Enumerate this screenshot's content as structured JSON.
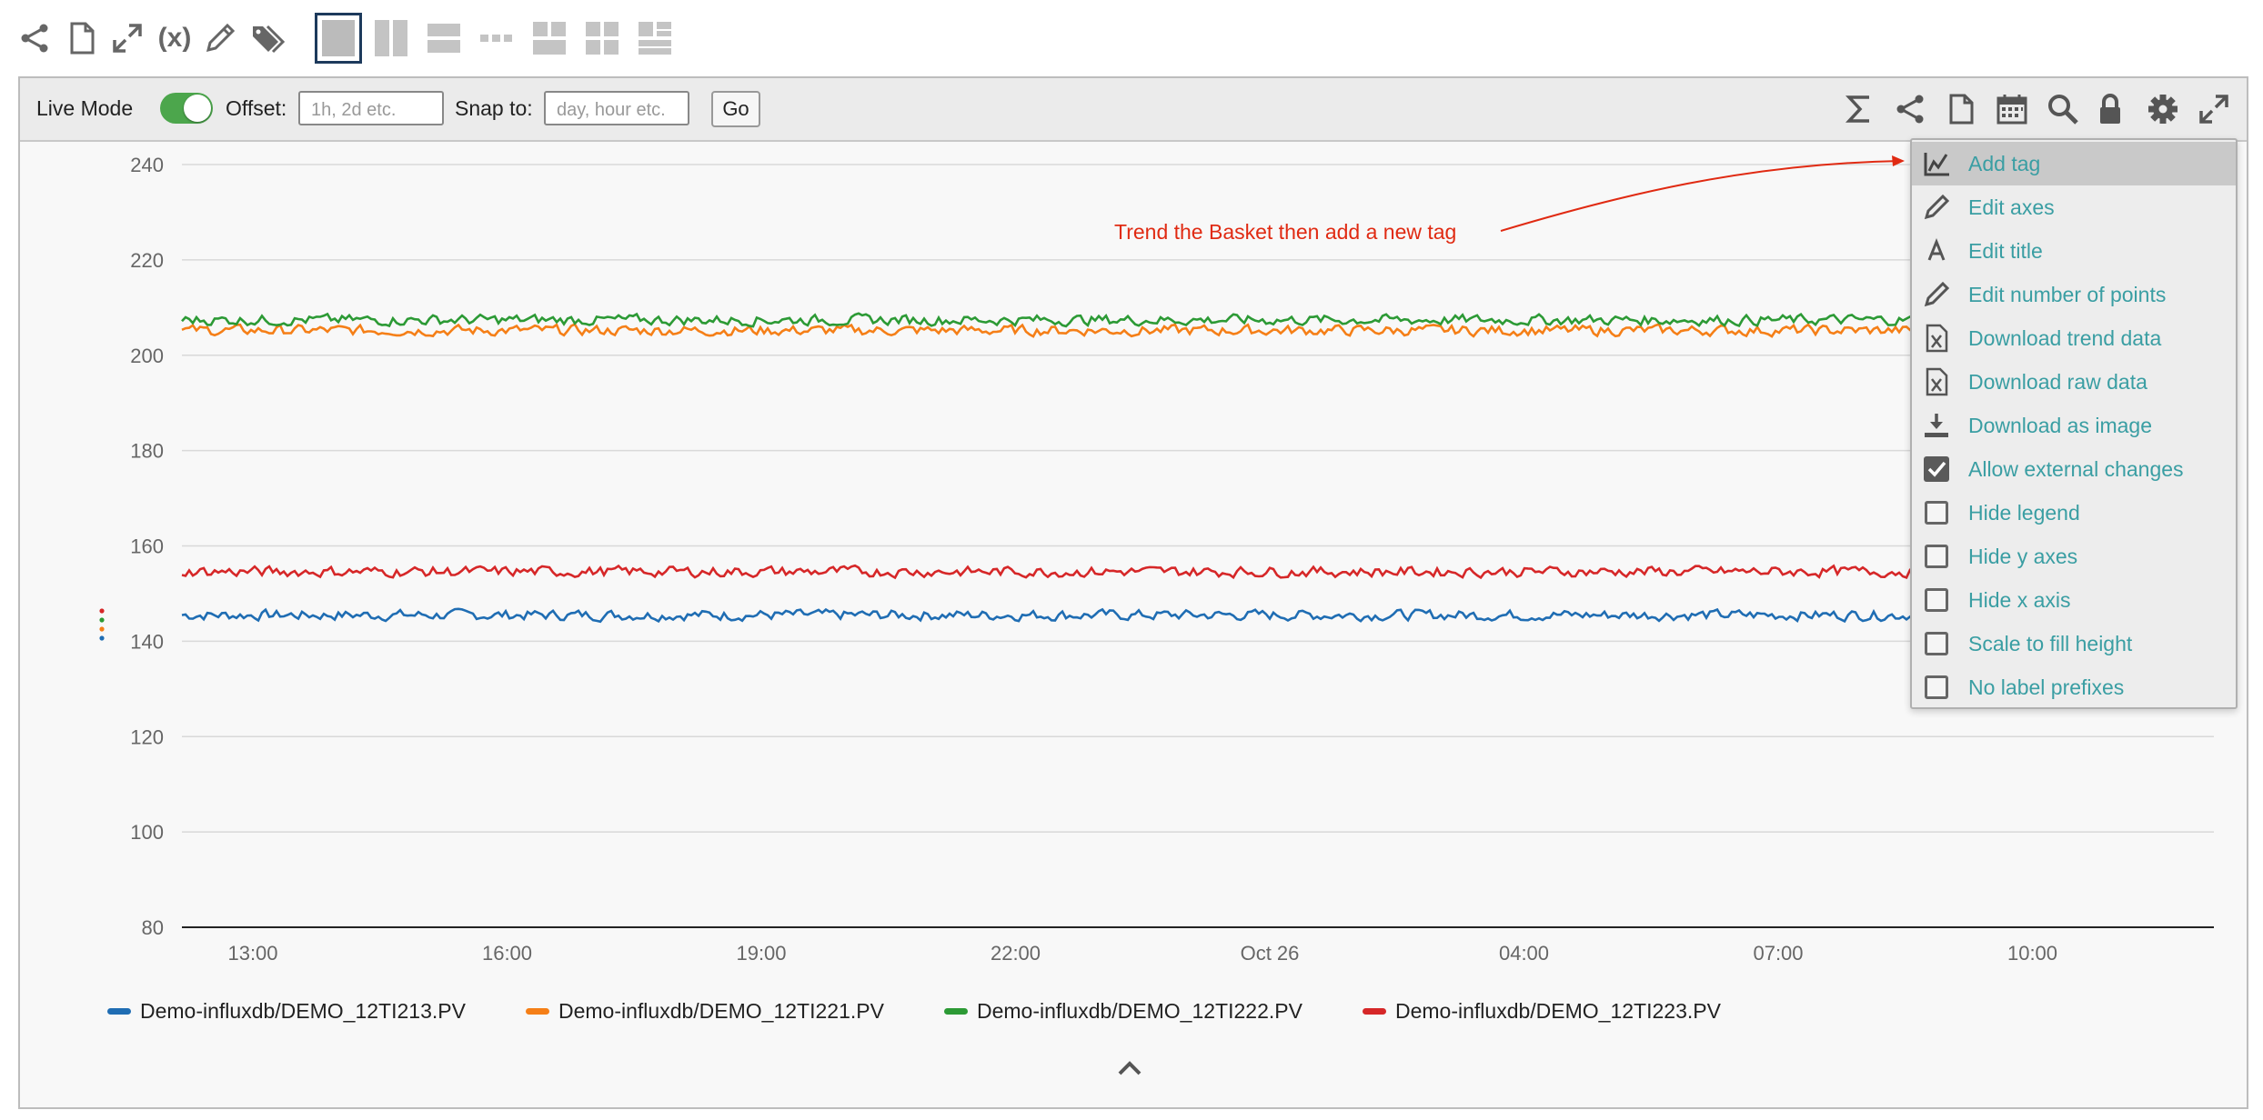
{
  "toolbar": {
    "variables_label": "(x)",
    "icons": [
      "share-icon",
      "new-document-icon",
      "expand-icon",
      "variables-icon",
      "edit-pencil-icon",
      "tags-icon"
    ],
    "layouts": [
      "single-layout",
      "two-columns-layout",
      "two-rows-layout",
      "strip-layout",
      "grid-2x2-layout",
      "grid-alt-layout",
      "grid-mixed-layout"
    ]
  },
  "controls": {
    "live_mode_label": "Live Mode",
    "live_mode_on": true,
    "offset_label": "Offset:",
    "offset_placeholder": "1h, 2d etc.",
    "snap_label": "Snap to:",
    "snap_placeholder": "day, hour etc.",
    "go_label": "Go",
    "right_tools": [
      "sum-icon",
      "share-icon",
      "document-icon",
      "calendar-icon",
      "search-icon",
      "lock-icon",
      "gear-icon",
      "fullscreen-icon"
    ]
  },
  "annotation": {
    "text": "Trend the Basket then add a new tag"
  },
  "chart_data": {
    "type": "line",
    "x_tick_labels": [
      "13:00",
      "16:00",
      "19:00",
      "22:00",
      "Oct 26",
      "04:00",
      "07:00",
      "10:00"
    ],
    "ylim": [
      80,
      240
    ],
    "y_ticks": [
      80,
      100,
      120,
      140,
      160,
      180,
      200,
      220,
      240
    ],
    "grid": true,
    "legend_placement": "bottom",
    "series": [
      {
        "name": "Demo-influxdb/DEMO_12TI213.PV",
        "color": "#1f6db3",
        "base": 145.5,
        "noise": 1.0
      },
      {
        "name": "Demo-influxdb/DEMO_12TI221.PV",
        "color": "#f57f17",
        "base": 205.2,
        "noise": 1.0
      },
      {
        "name": "Demo-influxdb/DEMO_12TI222.PV",
        "color": "#2c9a35",
        "base": 207.4,
        "noise": 1.0
      },
      {
        "name": "Demo-influxdb/DEMO_12TI223.PV",
        "color": "#d62728",
        "base": 154.6,
        "noise": 1.0
      }
    ]
  },
  "menu": {
    "items": [
      {
        "label": "Add tag",
        "icon": "chart-line-icon",
        "type": "action",
        "highlighted": true
      },
      {
        "label": "Edit axes",
        "icon": "pencil-icon",
        "type": "action"
      },
      {
        "label": "Edit title",
        "icon": "font-icon",
        "type": "action"
      },
      {
        "label": "Edit number of points",
        "icon": "pencil-icon",
        "type": "action"
      },
      {
        "label": "Download trend data",
        "icon": "excel-file-icon",
        "type": "action"
      },
      {
        "label": "Download raw data",
        "icon": "excel-file-icon",
        "type": "action"
      },
      {
        "label": "Download as image",
        "icon": "download-icon",
        "type": "action"
      },
      {
        "label": "Allow external changes",
        "icon": "checkbox-checked-icon",
        "type": "checkbox",
        "checked": true
      },
      {
        "label": "Hide legend",
        "icon": "checkbox-icon",
        "type": "checkbox",
        "checked": false
      },
      {
        "label": "Hide y axes",
        "icon": "checkbox-icon",
        "type": "checkbox",
        "checked": false
      },
      {
        "label": "Hide x axis",
        "icon": "checkbox-icon",
        "type": "checkbox",
        "checked": false
      },
      {
        "label": "Scale to fill height",
        "icon": "checkbox-icon",
        "type": "checkbox",
        "checked": false
      },
      {
        "label": "No label prefixes",
        "icon": "checkbox-icon",
        "type": "checkbox",
        "checked": false
      }
    ]
  }
}
